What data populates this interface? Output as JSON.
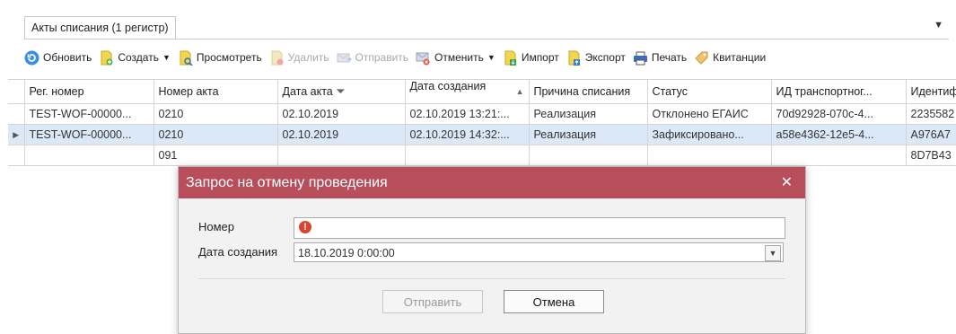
{
  "tab": {
    "label": "Акты списания (1 регистр)"
  },
  "toolbar": {
    "refresh": "Обновить",
    "create": "Создать",
    "view": "Просмотреть",
    "delete": "Удалить",
    "send": "Отправить",
    "cancel": "Отменить",
    "import": "Импорт",
    "export": "Экспорт",
    "print": "Печать",
    "receipts": "Квитанции"
  },
  "table": {
    "columns": [
      "Рег. номер",
      "Номер акта",
      "Дата акта",
      "Дата создания",
      "Причина списания",
      "Статус",
      "ИД транспортног...",
      "Идентиф"
    ],
    "rows": [
      [
        "TEST-WOF-00000...",
        "0210",
        "02.10.2019",
        "02.10.2019 13:21:...",
        "Реализация",
        "Отклонено ЕГАИС",
        "70d92928-070c-4...",
        "2235582"
      ],
      [
        "TEST-WOF-00000...",
        "0210",
        "02.10.2019",
        "02.10.2019 14:32:...",
        "Реализация",
        "Зафиксировано...",
        "a58e4362-12e5-4...",
        "A976A7"
      ],
      [
        "",
        "091",
        "",
        "",
        "",
        "",
        "",
        "8D7B43"
      ]
    ]
  },
  "dialog": {
    "title": "Запрос на отмену проведения",
    "number_label": "Номер",
    "number_value": "",
    "date_label": "Дата создания",
    "date_value": "18.10.2019 0:00:00",
    "send_button": "Отправить",
    "cancel_button": "Отмена"
  }
}
